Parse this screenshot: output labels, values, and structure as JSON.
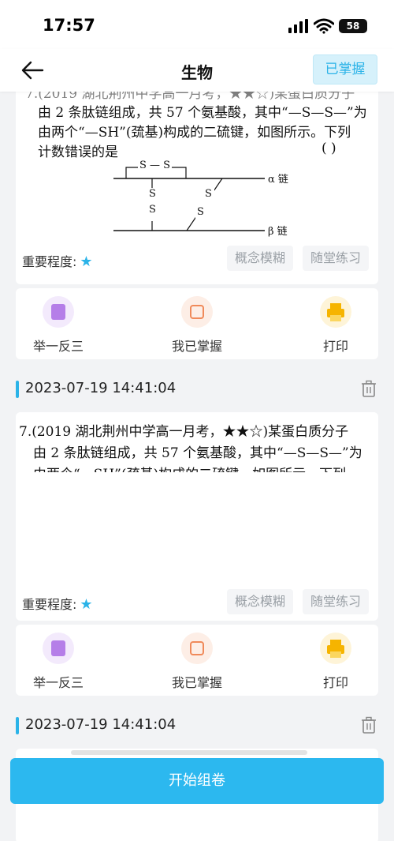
{
  "status_bar": {
    "time": "17:57",
    "battery": "58"
  },
  "nav": {
    "title": "生物",
    "mastered_label": "已掌握"
  },
  "question": {
    "line1": "7.(2019 湖北荆州中学高一月考，★★☆)某蛋白质分子",
    "line2": "由 2 条肽链组成，共 57 个氨基酸，其中“—S—S—”为",
    "line3": "由两个“—SH”(巯基)构成的二硫键，如图所示。下列",
    "line4": "计数错误的是",
    "paren": "(     )",
    "diagram": {
      "ss": "S — S",
      "s": "S",
      "alpha": "α 链",
      "beta": "β 链"
    }
  },
  "cards": [
    {
      "importance_label": "重要程度:",
      "tags": [
        "概念模糊",
        "随堂练习"
      ],
      "actions": {
        "similar": "举一反三",
        "mastered": "我已掌握",
        "print": "打印"
      }
    },
    {
      "date": "2023-07-19 14:41:04",
      "importance_label": "重要程度:",
      "tags": [
        "概念模糊",
        "随堂练习"
      ],
      "actions": {
        "similar": "举一反三",
        "mastered": "我已掌握",
        "print": "打印"
      }
    },
    {
      "date": "2023-07-19 14:41:04"
    }
  ],
  "start_button": "开始组卷",
  "colors": {
    "accent": "#2bb3e8",
    "button": "#2cb8ef",
    "mastered_bg": "#d6f1fb"
  },
  "icons": [
    "back-arrow-icon",
    "trash-icon",
    "similar-icon",
    "checkbox-icon",
    "printer-icon",
    "star-icon"
  ]
}
